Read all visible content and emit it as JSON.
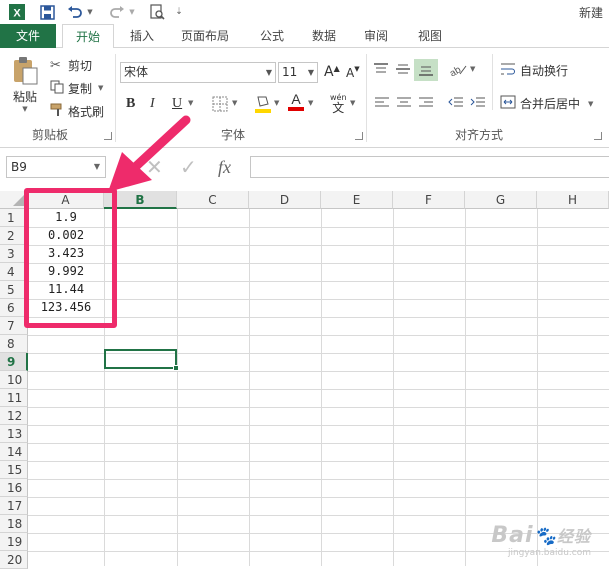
{
  "window": {
    "title": "新建"
  },
  "tabs": [
    "文件",
    "开始",
    "插入",
    "页面布局",
    "公式",
    "数据",
    "审阅",
    "视图"
  ],
  "ribbon": {
    "clipboard": {
      "paste": "粘贴",
      "cut": "剪切",
      "copy": "复制",
      "format_painter": "格式刷",
      "group": "剪贴板"
    },
    "font": {
      "name": "宋体",
      "size": "11",
      "bold": "B",
      "italic": "I",
      "underline": "U",
      "font_color_glyph": "A",
      "group": "字体"
    },
    "alignment": {
      "wrap_text": "自动换行",
      "merge_center": "合并后居中",
      "group": "对齐方式"
    }
  },
  "formula_bar": {
    "name_box": "B9",
    "fx": "fx"
  },
  "sheet": {
    "columns": [
      "A",
      "B",
      "C",
      "D",
      "E",
      "F",
      "G",
      "H"
    ],
    "selected_column": "B",
    "rows": [
      "1",
      "2",
      "3",
      "4",
      "5",
      "6",
      "7",
      "8",
      "9",
      "10",
      "11",
      "12",
      "13",
      "14",
      "15",
      "16",
      "17",
      "18",
      "19",
      "20"
    ],
    "selected_row": "9",
    "col_a_values": [
      "1.9",
      "0.002",
      "3.423",
      "9.992",
      "11.44",
      "123.456"
    ],
    "active_cell": "B9"
  },
  "annotation": {
    "color": "#ee2b6b"
  },
  "watermark": {
    "brand": "Bai",
    "brand2": "经验",
    "url": "jingyan.baidu.com"
  },
  "colors": {
    "accent": "#217346"
  }
}
